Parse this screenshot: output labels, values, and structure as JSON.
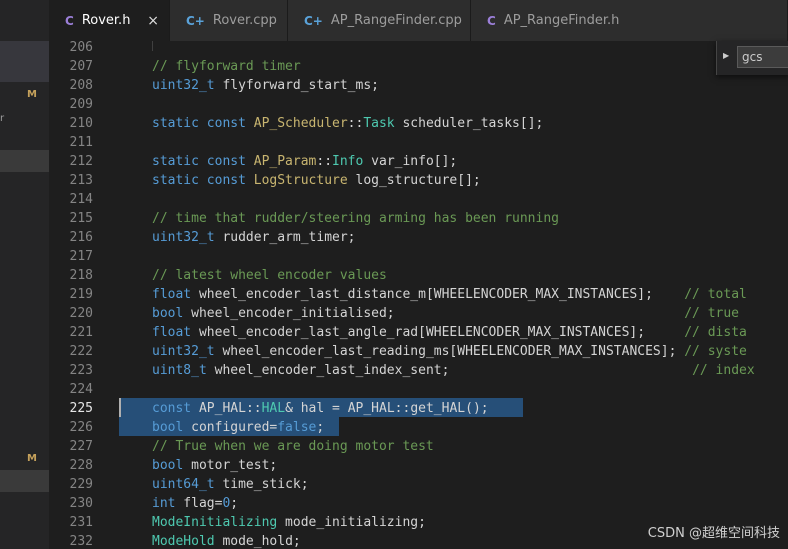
{
  "tabs": [
    {
      "icon": "C",
      "label": "Rover.h",
      "active": true,
      "close": "×"
    },
    {
      "icon": "C+",
      "label": "Rover.cpp",
      "active": false
    },
    {
      "icon": "C+",
      "label": "AP_RangeFinder.cpp",
      "active": false
    },
    {
      "icon": "C",
      "label": "AP_RangeFinder.h",
      "active": false
    }
  ],
  "sidebar": {
    "badges": [
      "M",
      "M"
    ],
    "letters": [
      "r"
    ]
  },
  "find": {
    "value": "gcs"
  },
  "editor": {
    "active_line": "225",
    "line_numbers": [
      "206",
      "207",
      "208",
      "209",
      "210",
      "211",
      "212",
      "213",
      "214",
      "215",
      "216",
      "217",
      "218",
      "219",
      "220",
      "221",
      "222",
      "223",
      "224",
      "225",
      "226",
      "227",
      "228",
      "229",
      "230",
      "231",
      "232"
    ],
    "lines": {
      "l207": "// flyforward timer",
      "l208a": "uint32_t",
      "l208b": " flyforward_start_ms;",
      "l210a": "static const ",
      "l210b": "AP_Scheduler",
      "l210c": "::",
      "l210d": "Task",
      "l210e": " scheduler_tasks[];",
      "l212a": "static const ",
      "l212b": "AP_Param",
      "l212c": "::",
      "l212d": "Info",
      "l212e": " var_info[];",
      "l213a": "static const ",
      "l213b": "LogStructure",
      "l213c": " log_structure[];",
      "l215": "// time that rudder/steering arming has been running",
      "l216a": "uint32_t",
      "l216b": " rudder_arm_timer;",
      "l218": "// latest wheel encoder values",
      "l219a": "float",
      "l219b": " wheel_encoder_last_distance_m[WHEELENCODER_MAX_INSTANCES];    ",
      "l219c": "// total",
      "l220a": "bool",
      "l220b": " wheel_encoder_initialised;                                     ",
      "l220c": "// true",
      "l221a": "float",
      "l221b": " wheel_encoder_last_angle_rad[WHEELENCODER_MAX_INSTANCES];     ",
      "l221c": "// dista",
      "l222a": "uint32_t",
      "l222b": " wheel_encoder_last_reading_ms[WHEELENCODER_MAX_INSTANCES]; ",
      "l222c": "// syste",
      "l223a": "uint8_t",
      "l223b": " wheel_encoder_last_index_sent;                               ",
      "l223c": "// index",
      "l225a": "const ",
      "l225b": "AP_HAL",
      "l225c": "::",
      "l225d": "HAL",
      "l225e": "& hal = ",
      "l225f": "AP_HAL",
      "l225g": "::get_HAL();",
      "l226a": "bool",
      "l226b": " configured=",
      "l226c": "false",
      "l226d": ";",
      "l227": "// True when we are doing motor test",
      "l228a": "bool",
      "l228b": " motor_test;",
      "l229a": "uint64_t",
      "l229b": " time_stick;",
      "l230a": "int",
      "l230b": " flag=",
      "l230c": "0",
      "l230d": ";",
      "l231a": "ModeInitializing",
      "l231b": " mode_initializing;",
      "l232a": "ModeHold",
      "l232b": " mode_hold;"
    }
  },
  "watermark": "CSDN @超维空间科技"
}
